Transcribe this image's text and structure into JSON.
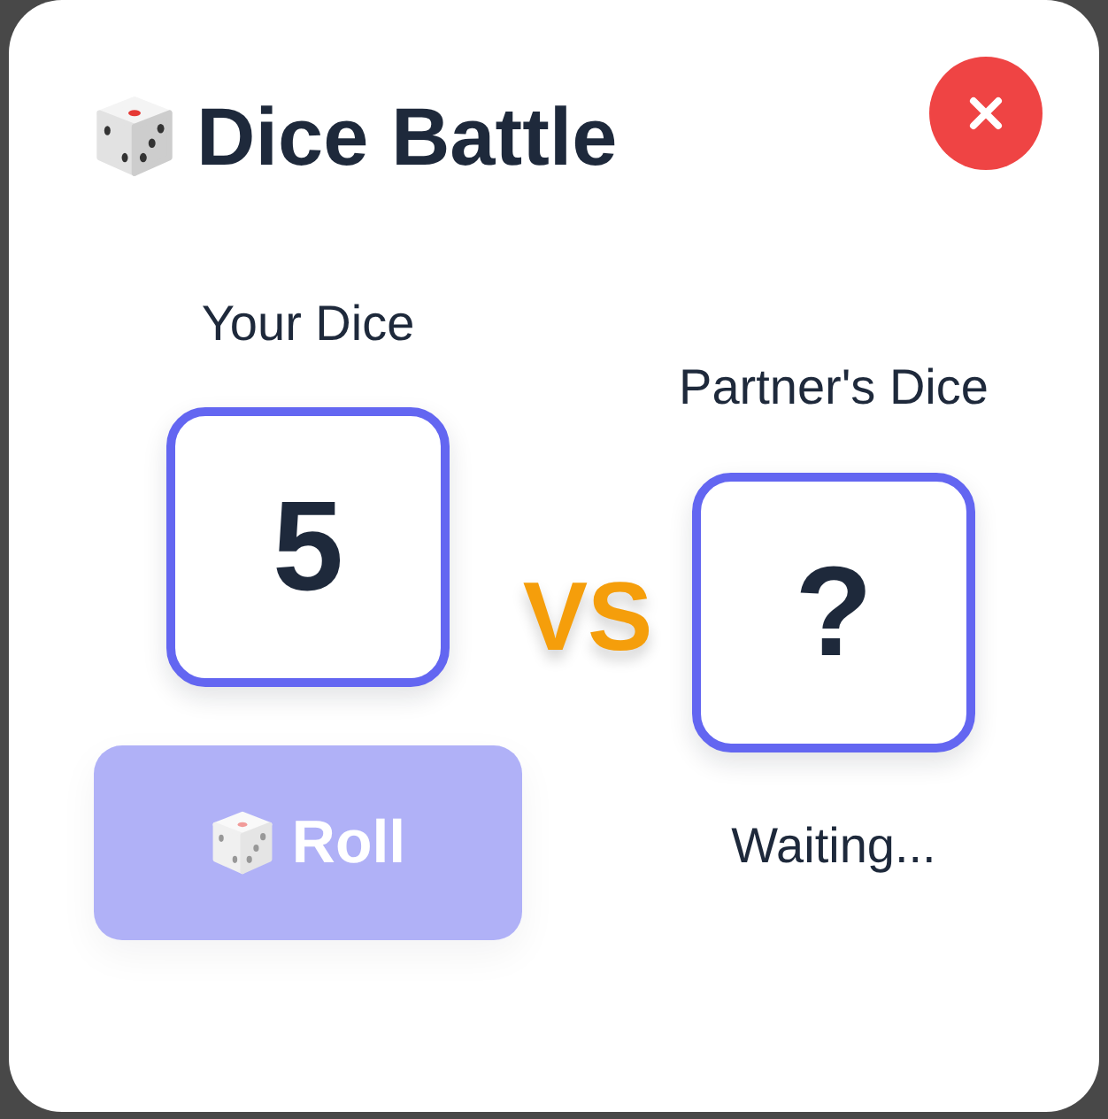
{
  "title": "Dice Battle",
  "players": [
    {
      "label": "Your Dice",
      "die": "5",
      "roll_button": {
        "label": "Roll",
        "disabled": true
      }
    },
    {
      "label": "Partner's Dice",
      "die": "?",
      "status": "Waiting..."
    }
  ],
  "versus": "VS"
}
